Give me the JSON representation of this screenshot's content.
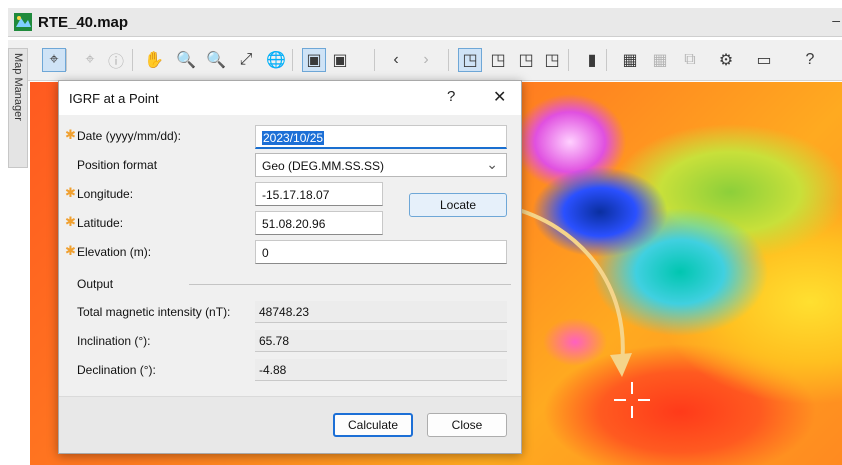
{
  "window": {
    "title": "RTE_40.map",
    "minimize": "–"
  },
  "side_panel": {
    "label": "Map Manager"
  },
  "toolbar": {
    "buttons": [
      {
        "name": "select-tool-icon",
        "glyph": "⌖"
      },
      {
        "name": "crosshair-icon",
        "glyph": "⌖"
      },
      {
        "name": "info-icon",
        "glyph": "ⓘ"
      },
      {
        "name": "pan-hand-icon",
        "glyph": "✋"
      },
      {
        "name": "zoom-window-icon",
        "glyph": "🔍"
      },
      {
        "name": "zoom-icon",
        "glyph": "🔍"
      },
      {
        "name": "zoom-extent-icon",
        "glyph": "⤢"
      },
      {
        "name": "globe-icon",
        "glyph": "🌐"
      },
      {
        "name": "layer-view-icon",
        "glyph": "▣"
      },
      {
        "name": "layer-edit-icon",
        "glyph": "▣"
      },
      {
        "name": "back-icon",
        "glyph": "‹"
      },
      {
        "name": "forward-icon",
        "glyph": "›"
      },
      {
        "name": "window-1-icon",
        "glyph": "◳"
      },
      {
        "name": "window-2-icon",
        "glyph": "◳"
      },
      {
        "name": "window-3-icon",
        "glyph": "◳"
      },
      {
        "name": "window-4-icon",
        "glyph": "◳"
      },
      {
        "name": "color-bar-icon",
        "glyph": "▮"
      },
      {
        "name": "grid-magnet-icon",
        "glyph": "▦"
      },
      {
        "name": "grid-icon",
        "glyph": "▦"
      },
      {
        "name": "plugin-icon",
        "glyph": "⧉"
      },
      {
        "name": "settings-gear-icon",
        "glyph": "⚙"
      },
      {
        "name": "camera-icon",
        "glyph": "▭"
      },
      {
        "name": "help-icon",
        "glyph": "?"
      }
    ]
  },
  "dialog": {
    "title": "IGRF at a Point",
    "help": "?",
    "close": "✕",
    "required_marker": "✱",
    "fields": {
      "date_label": "Date (yyyy/mm/dd):",
      "date_value": "2023/10/25",
      "position_format_label": "Position format",
      "position_format_value": "Geo (DEG.MM.SS.SS)",
      "longitude_label": "Longitude:",
      "longitude_value": "-15.17.18.07",
      "latitude_label": "Latitude:",
      "latitude_value": "51.08.20.96",
      "elevation_label": "Elevation (m):",
      "elevation_value": "0"
    },
    "locate_button": "Locate",
    "output": {
      "header": "Output",
      "total_label": "Total magnetic intensity (nT):",
      "total_value": "48748.23",
      "inclination_label": "Inclination (°):",
      "inclination_value": "65.78",
      "declination_label": "Declination (°):",
      "declination_value": "-4.88"
    },
    "calculate_button": "Calculate",
    "close_button": "Close"
  },
  "colors": {
    "accent": "#1c6fd6",
    "required": "#f0a030",
    "arrow": "#f5d48a"
  }
}
